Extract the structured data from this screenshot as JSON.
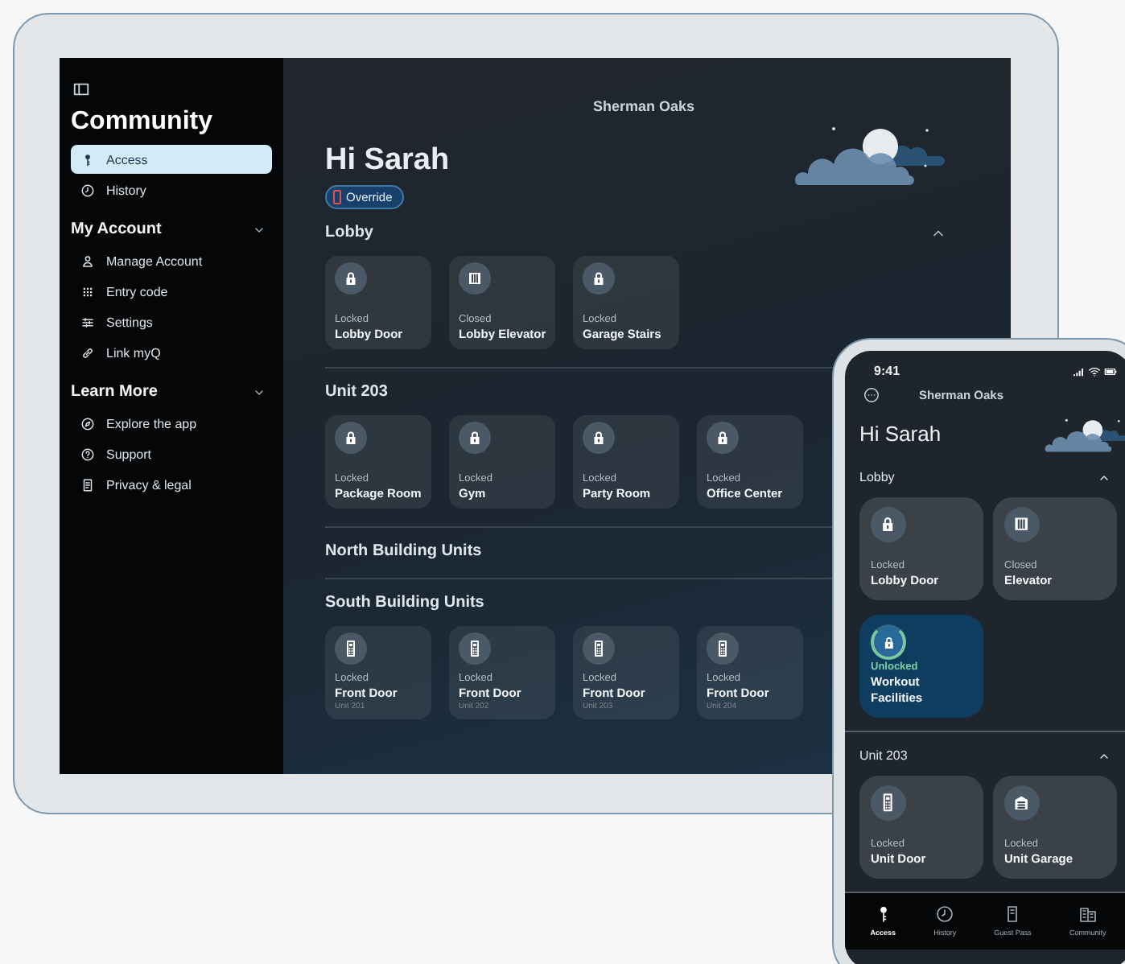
{
  "tablet": {
    "sidebar": {
      "title": "Community",
      "top_items": [
        {
          "label": "Access",
          "kind": "key",
          "selected": true
        },
        {
          "label": "History",
          "kind": "clock",
          "selected": false
        }
      ],
      "groups": [
        {
          "title": "My Account",
          "expanded": true,
          "items": [
            {
              "label": "Manage Account",
              "kind": "person",
              "selected": false
            },
            {
              "label": "Entry code",
              "kind": "grid",
              "selected": false
            },
            {
              "label": "Settings",
              "kind": "sliders",
              "selected": false
            },
            {
              "label": "Link myQ",
              "kind": "link",
              "selected": false
            }
          ]
        },
        {
          "title": "Learn More",
          "expanded": true,
          "items": [
            {
              "label": "Explore the app",
              "kind": "compass",
              "selected": false
            },
            {
              "label": "Support",
              "kind": "question",
              "selected": false
            },
            {
              "label": "Privacy & legal",
              "kind": "document",
              "selected": false
            }
          ]
        }
      ]
    },
    "location": "Sherman Oaks",
    "greeting": "Hi Sarah",
    "override_badge": "Override",
    "sections": [
      {
        "title": "Lobby",
        "expanded": true,
        "tiles": [
          {
            "kind": "lock",
            "status": "Locked",
            "name": "Lobby Door",
            "unlocked": false
          },
          {
            "kind": "elevator",
            "status": "Closed",
            "name": "Lobby Elevator",
            "unlocked": false
          },
          {
            "kind": "lock",
            "status": "Locked",
            "name": "Garage Stairs",
            "unlocked": false
          }
        ]
      },
      {
        "title": "Unit 203",
        "tiles": [
          {
            "kind": "lock",
            "status": "Locked",
            "name": "Package Room",
            "unlocked": false
          },
          {
            "kind": "lock",
            "status": "Locked",
            "name": "Gym",
            "unlocked": false
          },
          {
            "kind": "lock",
            "status": "Locked",
            "name": "Party Room",
            "unlocked": false
          },
          {
            "kind": "lock",
            "status": "Locked",
            "name": "Office Center",
            "unlocked": false
          }
        ]
      },
      {
        "title": "North Building Units"
      },
      {
        "title": "South Building Units",
        "tiles": [
          {
            "kind": "keypad",
            "status": "Locked",
            "name": "Front Door",
            "sub": "Unit 201",
            "unlocked": false
          },
          {
            "kind": "keypad",
            "status": "Locked",
            "name": "Front Door",
            "sub": "Unit 202",
            "unlocked": false
          },
          {
            "kind": "keypad",
            "status": "Locked",
            "name": "Front Door",
            "sub": "Unit 203",
            "unlocked": false
          },
          {
            "kind": "keypad",
            "status": "Locked",
            "name": "Front Door",
            "sub": "Unit 204",
            "unlocked": false
          }
        ]
      }
    ]
  },
  "phone": {
    "time": "9:41",
    "location": "Sherman Oaks",
    "greeting": "Hi Sarah",
    "sections": [
      {
        "title": "Lobby",
        "expanded": true,
        "tiles": [
          {
            "kind": "lock",
            "status": "Locked",
            "name": "Lobby Door",
            "unlocked": false
          },
          {
            "kind": "elevator",
            "status": "Closed",
            "name": "Elevator",
            "unlocked": false
          },
          {
            "kind": "lock",
            "status": "Unlocked",
            "name": "Workout Facilities",
            "unlocked": true
          }
        ]
      },
      {
        "title": "Unit 203",
        "expanded": true,
        "tiles": [
          {
            "kind": "keypad",
            "status": "Locked",
            "name": "Unit Door",
            "unlocked": false
          },
          {
            "kind": "garage",
            "status": "Locked",
            "name": "Unit Garage",
            "unlocked": false
          }
        ]
      }
    ],
    "tabs": [
      {
        "label": "Access",
        "kind": "key",
        "selected": true
      },
      {
        "label": "History",
        "kind": "clock",
        "selected": false
      },
      {
        "label": "Guest Pass",
        "kind": "pass",
        "selected": false
      },
      {
        "label": "Community",
        "kind": "building",
        "selected": false
      }
    ]
  }
}
